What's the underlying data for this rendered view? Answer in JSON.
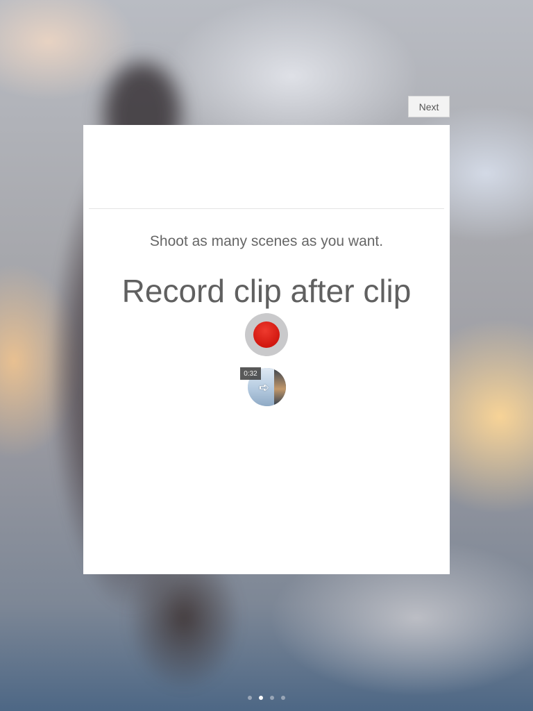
{
  "header": {
    "next_label": "Next"
  },
  "onboarding": {
    "title": "Record clip after clip",
    "subtitle": "Shoot as many scenes as you want."
  },
  "clip": {
    "duration": "0:32"
  },
  "icons": {
    "record": "record-icon",
    "clip_thumbnail": "clip-thumbnail",
    "arrow": "arrow-right-icon"
  },
  "pager": {
    "total": 4,
    "active_index": 1
  },
  "colors": {
    "record_red": "#d1170f",
    "record_ring": "#c9c9cb",
    "card": "#ffffff"
  }
}
